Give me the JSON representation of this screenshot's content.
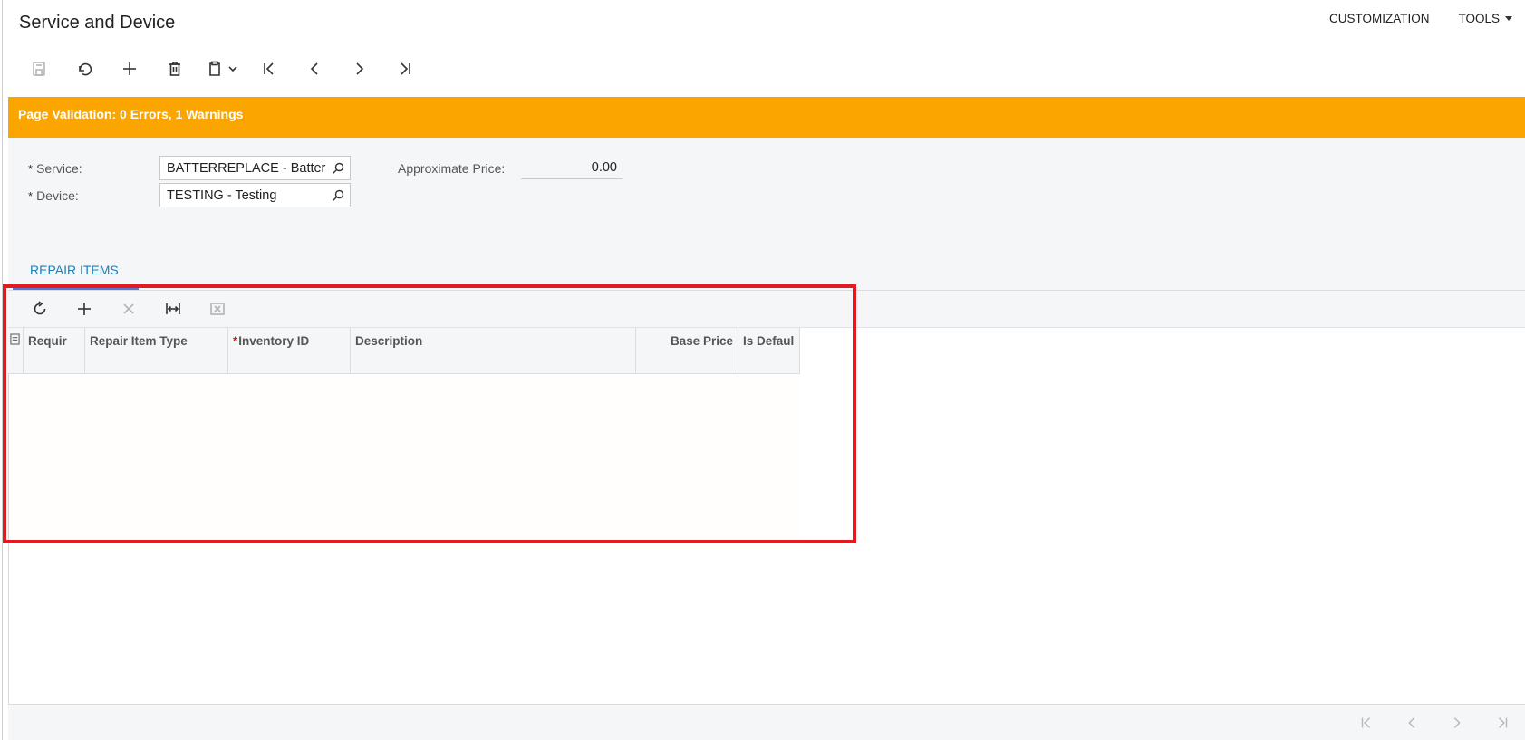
{
  "header": {
    "title": "Service and Device",
    "nav": [
      {
        "label": "CUSTOMIZATION"
      },
      {
        "label": "TOOLS"
      }
    ]
  },
  "toolbar": {
    "buttons": [
      {
        "icon": "save-icon",
        "enabled": false
      },
      {
        "icon": "undo-icon",
        "enabled": true
      },
      {
        "icon": "add-icon",
        "enabled": true
      },
      {
        "icon": "delete-icon",
        "enabled": true
      },
      {
        "icon": "paste-icon",
        "enabled": true
      },
      {
        "icon": "first-record-icon",
        "enabled": true
      },
      {
        "icon": "previous-record-icon",
        "enabled": true
      },
      {
        "icon": "next-record-icon",
        "enabled": true
      },
      {
        "icon": "last-record-icon",
        "enabled": true
      }
    ]
  },
  "validation": {
    "message": "Page Validation: 0 Errors, 1 Warnings",
    "color": "#fba500"
  },
  "form": {
    "service": {
      "label": "Service:",
      "required_mark": "*",
      "value": "BATTERREPLACE - Batter"
    },
    "device": {
      "label": "Device:",
      "required_mark": "*",
      "value": "TESTING - Testing"
    },
    "approx_price": {
      "label": "Approximate Price:",
      "value": "0.00"
    }
  },
  "tabs": [
    {
      "label": "REPAIR ITEMS",
      "active": true
    }
  ],
  "grid": {
    "toolbar": [
      {
        "icon": "refresh-icon",
        "enabled": true
      },
      {
        "icon": "add-row-icon",
        "enabled": true
      },
      {
        "icon": "delete-row-icon",
        "enabled": false
      },
      {
        "icon": "fit-columns-icon",
        "enabled": true
      },
      {
        "icon": "export-excel-icon",
        "enabled": false
      }
    ],
    "columns": [
      {
        "label": "Requir"
      },
      {
        "label": "Repair Item Type"
      },
      {
        "label": "Inventory ID",
        "required_mark": "*"
      },
      {
        "label": "Description"
      },
      {
        "label": "Base Price"
      },
      {
        "label": "Is Defaul"
      }
    ],
    "rows": []
  },
  "colors": {
    "accent_tab": "#1d7fb8",
    "highlight_border": "#e21b23"
  }
}
